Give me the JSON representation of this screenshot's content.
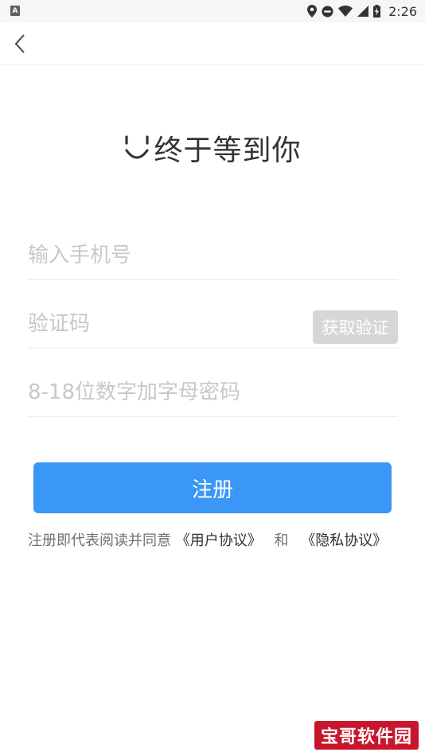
{
  "status_bar": {
    "app_icon_letter": "A",
    "time": "2:26",
    "icons": [
      "location-icon",
      "do-not-disturb-icon",
      "wifi-icon",
      "signal-icon",
      "battery-charging-icon"
    ]
  },
  "nav": {
    "back_icon": "chevron-left-icon"
  },
  "hero": {
    "smile_icon": "smile-icon",
    "title": "终于等到你"
  },
  "form": {
    "phone": {
      "placeholder": "输入手机号",
      "value": ""
    },
    "code": {
      "placeholder": "验证码",
      "value": "",
      "get_code_label": "获取验证"
    },
    "password": {
      "placeholder": "8-18位数字加字母密码",
      "value": ""
    }
  },
  "register_button_label": "注册",
  "agreement": {
    "prefix": "注册即代表阅读并同意",
    "user_agreement": "《用户协议》",
    "conjunction": "和",
    "privacy_agreement": "《隐私协议》"
  },
  "watermark": "宝哥软件园",
  "colors": {
    "primary": "#3b97f6",
    "disabled_button": "#d6d6d6",
    "watermark_bg": "#c8162c"
  }
}
